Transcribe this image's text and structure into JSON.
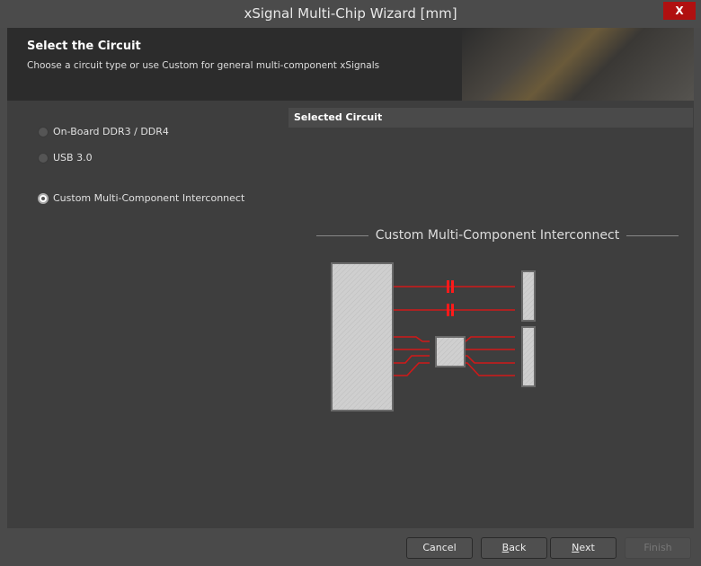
{
  "window": {
    "title": "xSignal Multi-Chip Wizard [mm]",
    "close_label": "X"
  },
  "header": {
    "title": "Select the Circuit",
    "subtitle": "Choose a circuit type or use Custom for general multi-component xSignals"
  },
  "options": [
    {
      "label": "On-Board DDR3 / DDR4",
      "selected": false
    },
    {
      "label": "USB 3.0",
      "selected": false
    },
    {
      "label": "Custom Multi-Component Interconnect",
      "selected": true
    }
  ],
  "selected_panel": {
    "heading": "Selected Circuit",
    "diagram_title": "Custom Multi-Component Interconnect"
  },
  "colors": {
    "trace": "#d01818",
    "accent_close": "#b01010"
  },
  "buttons": {
    "cancel": "Cancel",
    "back_mnemonic": "B",
    "back_rest": "ack",
    "next_mnemonic": "N",
    "next_rest": "ext",
    "finish": "Finish"
  }
}
